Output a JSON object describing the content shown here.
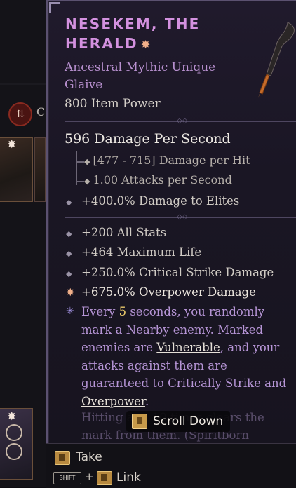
{
  "item": {
    "name": "Nesekem, the Herald",
    "rarity_line": "Ancestral Mythic Unique",
    "type_line": "Glaive",
    "item_power": "800 Item Power",
    "dps": "596 Damage Per Second",
    "damage_per_hit": "[477 - 715] Damage per Hit",
    "attacks_per_second": "1.00 Attacks per Second",
    "implicit": "+400.0% Damage to Elites",
    "affixes": [
      "+200 All Stats",
      "+464 Maximum Life",
      "+250.0% Critical Strike Damage"
    ],
    "legendary_affix": "+675.0% Overpower Damage",
    "unique_power": {
      "p1": "Every ",
      "num": "5",
      "p2": " seconds, you randomly mark a Nearby enemy. Marked enemies are ",
      "kw1": "Vulnerable",
      "p3": ", and your attacks against them are guaranteed to Critically Strike and ",
      "kw2": "Overpower",
      "p4": "."
    },
    "faded_text": "Hitting a ... 10 times clears the mark from them. (Spiritborn"
  },
  "scroll_hint": "Scroll Down",
  "footer": {
    "take_label": "Take",
    "shift_label": "SHIFT",
    "plus": "+",
    "link_label": "Link"
  },
  "colors": {
    "mythic_title": "#d391df",
    "rarity_text": "#b890cf",
    "unique_power_text": "#b695d6",
    "number_highlight": "#e8c86a"
  }
}
